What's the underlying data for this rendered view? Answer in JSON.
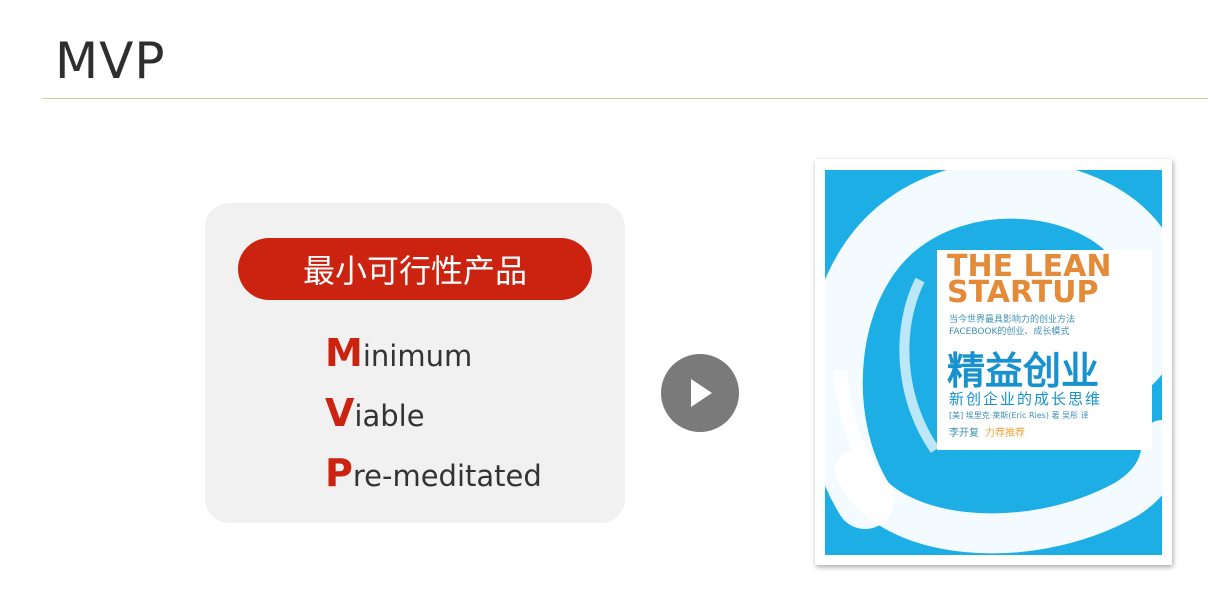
{
  "slide": {
    "title": "MVP"
  },
  "card": {
    "pill_label": "最小可行性产品",
    "terms": [
      {
        "cap": "M",
        "rest": "inimum"
      },
      {
        "cap": "V",
        "rest": "iable"
      },
      {
        "cap": "P",
        "rest": "re-meditated"
      }
    ]
  },
  "book": {
    "english_title_line1": "THE LEAN",
    "english_title_line2": "STARTUP",
    "tagline1": "当今世界最具影响力的创业方法",
    "tagline2": "FACEBOOK的创业、成长模式",
    "chinese_title": "精益创业",
    "chinese_subtitle": "新创企业的成长思维",
    "author_line": "[美] 埃里克·莱斯(Eric Ries) 著   吴彤 译",
    "recommender": "李开复",
    "recommend_text": "力荐推荐"
  },
  "colors": {
    "accent_red": "#cc2210",
    "book_blue": "#1daee6",
    "play_gray": "#7a7a7a"
  },
  "icons": {
    "play": "play-icon"
  }
}
